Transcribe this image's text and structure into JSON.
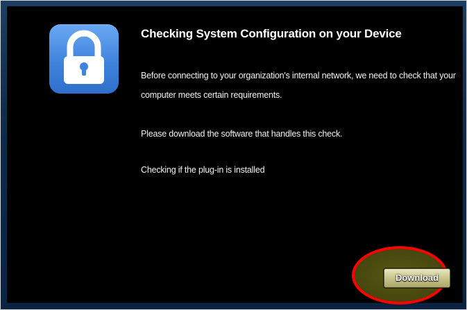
{
  "dialog": {
    "title": "Checking System Configuration on your Device",
    "paragraph1": "Before connecting to your organization's internal network, we need to check that your computer meets certain requirements.",
    "paragraph2": "Please download the software that handles this check.",
    "status_text": "Checking if the plug-in is installed",
    "download_label": "Download"
  },
  "icons": {
    "main_icon": "lock-icon"
  },
  "colors": {
    "panel_background": "#000000",
    "frame_background": "#0f2a4a",
    "lock_tile": "#3f83dd",
    "highlight_circle": "#ff0000",
    "button_face": "#c8c48c"
  }
}
